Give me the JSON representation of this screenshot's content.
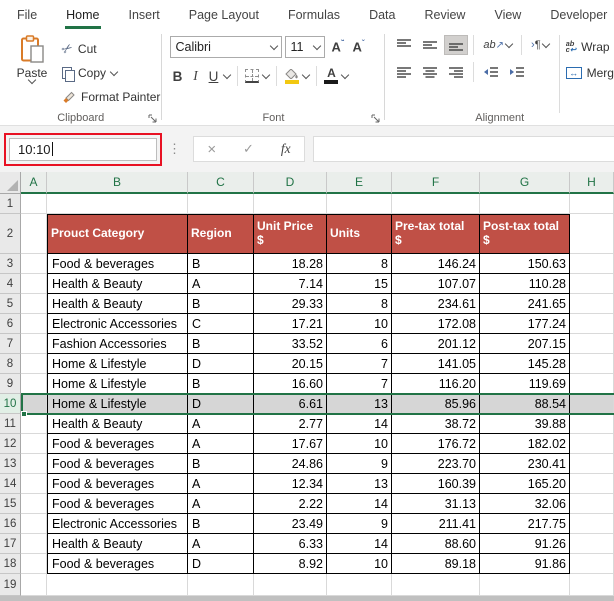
{
  "ribbon": {
    "tabs": [
      "File",
      "Home",
      "Insert",
      "Page Layout",
      "Formulas",
      "Data",
      "Review",
      "View",
      "Developer"
    ],
    "active_tab": "Home",
    "groups": {
      "clipboard": {
        "label": "Clipboard",
        "paste": "Paste",
        "cut": "Cut",
        "copy": "Copy",
        "format_painter": "Format Painter"
      },
      "font": {
        "label": "Font",
        "font_name": "Calibri",
        "font_size": "11",
        "bold": "B",
        "italic": "I",
        "underline": "U"
      },
      "alignment": {
        "label": "Alignment",
        "wrap": "Wrap",
        "merge": "Merg",
        "orientation_glyph": "ab",
        "text_direction_glyph": "¶"
      }
    }
  },
  "formula_bar": {
    "name_box_value": "10:10",
    "cancel_glyph": "×",
    "enter_glyph": "✓",
    "fx_label": "fx",
    "formula_value": ""
  },
  "sheet": {
    "column_headers": [
      "A",
      "B",
      "C",
      "D",
      "E",
      "F",
      "G",
      "H"
    ],
    "row_headers": [
      "1",
      "2",
      "3",
      "4",
      "5",
      "6",
      "7",
      "8",
      "9",
      "10",
      "11",
      "12",
      "13",
      "14",
      "15",
      "16",
      "17",
      "18",
      "19"
    ],
    "selected_row": 10,
    "selected_range": "10:10",
    "table": {
      "first_data_row": 3,
      "headers": [
        "Prouct Category",
        "Region",
        "Unit Price\n$",
        "Units",
        "Pre-tax total\n$",
        "Post-tax total\n$"
      ],
      "rows": [
        [
          "Food & beverages",
          "B",
          "18.28",
          "8",
          "146.24",
          "150.63"
        ],
        [
          "Health & Beauty",
          "A",
          "7.14",
          "15",
          "107.07",
          "110.28"
        ],
        [
          "Health & Beauty",
          "B",
          "29.33",
          "8",
          "234.61",
          "241.65"
        ],
        [
          "Electronic Accessories",
          "C",
          "17.21",
          "10",
          "172.08",
          "177.24"
        ],
        [
          "Fashion Accessories",
          "B",
          "33.52",
          "6",
          "201.12",
          "207.15"
        ],
        [
          "Home & Lifestyle",
          "D",
          "20.15",
          "7",
          "141.05",
          "145.28"
        ],
        [
          "Home & Lifestyle",
          "B",
          "16.60",
          "7",
          "116.20",
          "119.69"
        ],
        [
          "Home & Lifestyle",
          "D",
          "6.61",
          "13",
          "85.96",
          "88.54"
        ],
        [
          "Health & Beauty",
          "A",
          "2.77",
          "14",
          "38.72",
          "39.88"
        ],
        [
          "Food & beverages",
          "A",
          "17.67",
          "10",
          "176.72",
          "182.02"
        ],
        [
          "Food & beverages",
          "B",
          "24.86",
          "9",
          "223.70",
          "230.41"
        ],
        [
          "Food & beverages",
          "A",
          "12.34",
          "13",
          "160.39",
          "165.20"
        ],
        [
          "Food & beverages",
          "A",
          "2.22",
          "14",
          "31.13",
          "32.06"
        ],
        [
          "Electronic Accessories",
          "B",
          "23.49",
          "9",
          "211.41",
          "217.75"
        ],
        [
          "Health & Beauty",
          "A",
          "6.33",
          "14",
          "88.60",
          "91.26"
        ],
        [
          "Food & beverages",
          "D",
          "8.92",
          "10",
          "89.18",
          "91.86"
        ]
      ]
    }
  },
  "colors": {
    "excel_green": "#217346",
    "table_header_fill": "#C05046",
    "selected_row_fill": "#D6D6D6",
    "annotation_red": "#E81123"
  }
}
